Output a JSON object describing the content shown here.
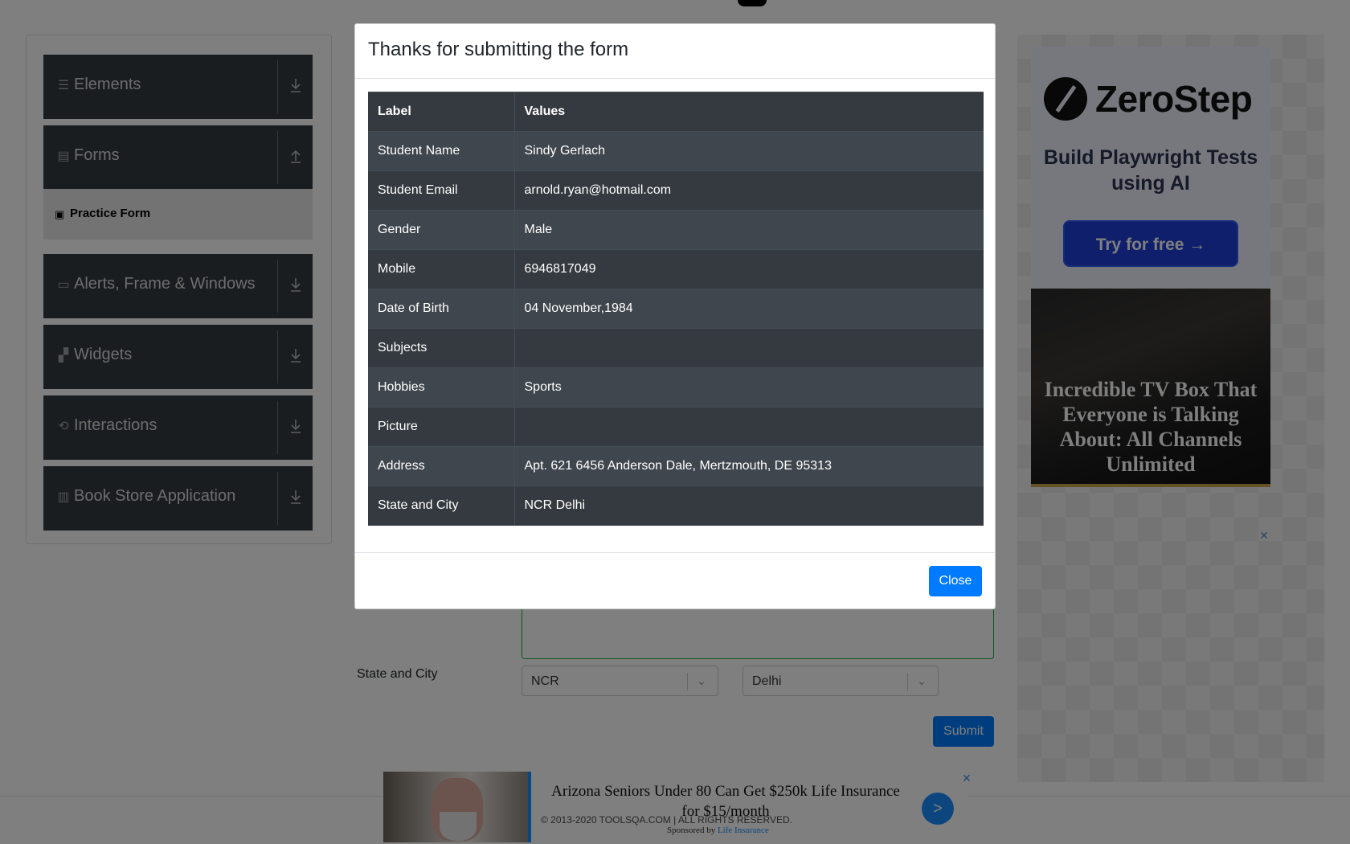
{
  "sidebar": {
    "groups": [
      {
        "label": "Elements",
        "icon": "list-icon",
        "expanded": false
      },
      {
        "label": "Forms",
        "icon": "document-icon",
        "expanded": true
      },
      {
        "label": "Alerts, Frame & Windows",
        "icon": "window-icon",
        "expanded": false
      },
      {
        "label": "Widgets",
        "icon": "widgets-icon",
        "expanded": false
      },
      {
        "label": "Interactions",
        "icon": "interactions-icon",
        "expanded": false
      },
      {
        "label": "Book Store Application",
        "icon": "books-icon",
        "expanded": false
      }
    ],
    "active_item": "Practice Form"
  },
  "form": {
    "state_city_label": "State and City",
    "state_value": "NCR",
    "city_value": "Delhi",
    "submit_label": "Submit"
  },
  "footer": {
    "text": "© 2013-2020 TOOLSQA.COM | ALL RIGHTS RESERVED."
  },
  "ads": {
    "zerostep": {
      "brand": "ZeroStep",
      "headline": "Build Playwright Tests using AI",
      "cta": "Try for free →"
    },
    "tvbox": {
      "text": "Incredible TV Box That Everyone is Talking About: All Channels Unlimited"
    },
    "bottom": {
      "title": "Arizona Seniors Under 80 Can Get $250k Life Insurance for $15/month",
      "go_label": ">",
      "sponsored_prefix": "Sponsored by",
      "sponsor": "Life Insurance"
    }
  },
  "modal": {
    "title": "Thanks for submitting the form",
    "columns": [
      "Label",
      "Values"
    ],
    "rows": [
      [
        "Student Name",
        "Sindy Gerlach"
      ],
      [
        "Student Email",
        "arnold.ryan@hotmail.com"
      ],
      [
        "Gender",
        "Male"
      ],
      [
        "Mobile",
        "6946817049"
      ],
      [
        "Date of Birth",
        "04 November,1984"
      ],
      [
        "Subjects",
        ""
      ],
      [
        "Hobbies",
        "Sports"
      ],
      [
        "Picture",
        ""
      ],
      [
        "Address",
        "Apt. 621 6456 Anderson Dale, Mertzmouth, DE 95313"
      ],
      [
        "State and City",
        "NCR Delhi"
      ]
    ],
    "close_label": "Close"
  },
  "colors": {
    "accent": "#007bff",
    "table_dark": "#343a40",
    "nav_bg": "#343a40"
  }
}
